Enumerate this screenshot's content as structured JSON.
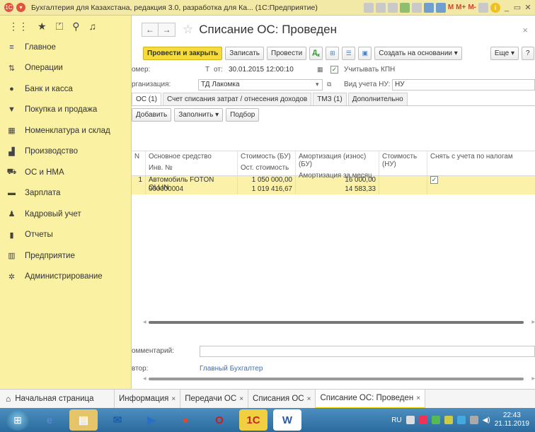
{
  "app_title": "Бухгалтерия для Казахстана, редакция 3.0, разработка для Ка... (1С:Предприятие)",
  "titlebar_icons": {
    "m": "M",
    "m_plus": "M+",
    "m_minus": "M-",
    "window_controls": [
      "_",
      "▭",
      "✕"
    ]
  },
  "sidebar": {
    "items": [
      {
        "label": "Главное",
        "icon": "menu-lines-icon"
      },
      {
        "label": "Операции",
        "icon": "operations-icon"
      },
      {
        "label": "Банк и касса",
        "icon": "coin-icon"
      },
      {
        "label": "Покупка и продажа",
        "icon": "cart-icon"
      },
      {
        "label": "Номенклатура и склад",
        "icon": "warehouse-icon"
      },
      {
        "label": "Производство",
        "icon": "factory-icon"
      },
      {
        "label": "ОС и НМА",
        "icon": "truck-icon"
      },
      {
        "label": "Зарплата",
        "icon": "wallet-icon"
      },
      {
        "label": "Кадровый учет",
        "icon": "people-icon"
      },
      {
        "label": "Отчеты",
        "icon": "bar-chart-icon"
      },
      {
        "label": "Предприятие",
        "icon": "building-icon"
      },
      {
        "label": "Администрирование",
        "icon": "gear-icon"
      }
    ]
  },
  "form": {
    "title": "Списание ОС: Проведен",
    "buttons": {
      "post_and_close": "Провести и закрыть",
      "save": "Записать",
      "post": "Провести",
      "create_based_on": "Создать на основании",
      "more": "Еще",
      "help": "?"
    },
    "number_label": "омер:",
    "number_value": "Т",
    "from_label": "от:",
    "date_value": "30.01.2015 12:00:10",
    "kpn_label": "Учитывать КПН",
    "kpn_checked": true,
    "org_label": "рганизация:",
    "org_value": "ТД Лакомка",
    "nu_type_label": "Вид учета НУ:",
    "nu_type_value": "НУ",
    "comment_label": "омментарий:",
    "comment_value": "",
    "author_label": "втор:",
    "author_value": "Главный Бухгалтер"
  },
  "tabs": [
    {
      "label": "ОС (1)",
      "active": true
    },
    {
      "label": "Счет списания затрат / отнесения доходов",
      "active": false
    },
    {
      "label": "ТМЗ (1)",
      "active": false
    },
    {
      "label": "Дополнительно",
      "active": false
    }
  ],
  "table_toolbar": {
    "add": "Добавить",
    "fill": "Заполнить",
    "pick": "Подбор"
  },
  "table": {
    "headers": {
      "n": "N",
      "asset": "Основное средство",
      "inv": "Инв. №",
      "cost_bu": "Стоимость (БУ)",
      "residual": "Ост. стоимость",
      "amort_bu": "Амортизация (износ) (БУ)",
      "amort_month": "Амортизация за месяц",
      "cost_nu": "Стоимость (НУ)",
      "remove_tax": "Снять с учета по налогам"
    },
    "rows": [
      {
        "n": "1",
        "asset": "Автомобиль FOTON OLLIN",
        "inv": "000000004",
        "cost_bu": "1 050 000,00",
        "residual": "1 019 416,67",
        "amort_bu": "16 000,00",
        "amort_month": "14 583,33",
        "cost_nu": "",
        "remove_tax": true
      }
    ]
  },
  "open_windows": [
    {
      "label": "Начальная страница",
      "closable": false,
      "active": false
    },
    {
      "label": "Информация",
      "closable": true,
      "active": false
    },
    {
      "label": "Передачи ОС",
      "closable": true,
      "active": false
    },
    {
      "label": "Списания ОС",
      "closable": true,
      "active": false
    },
    {
      "label": "Списание ОС: Проведен",
      "closable": true,
      "active": true
    }
  ],
  "taskbar": {
    "lang": "RU",
    "time": "22:43",
    "date": "21.11.2019",
    "apps": [
      "ie",
      "explorer",
      "outlook",
      "media-player",
      "chrome",
      "opera",
      "1c",
      "word"
    ],
    "app_labels": {
      "opera": "O",
      "onec": "1С",
      "word": "W"
    }
  }
}
